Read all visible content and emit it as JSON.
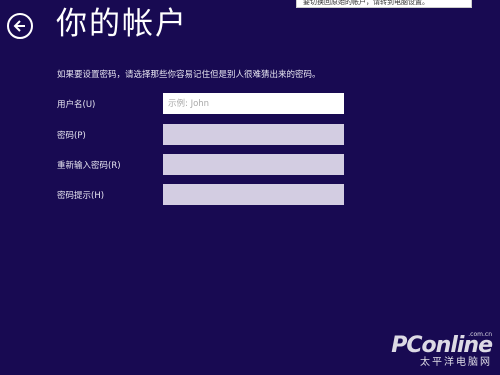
{
  "tooltip": {
    "text": "要切换回原始的帐户，请转到电脑设置。"
  },
  "header": {
    "back_icon": "back-arrow-icon",
    "title": "你的帐户"
  },
  "form": {
    "instruction": "如果要设置密码，请选择那些你容易记住但是别人很难猜出来的密码。",
    "fields": [
      {
        "label": "用户名(U)",
        "value": "",
        "placeholder": "示例: John"
      },
      {
        "label": "密码(P)",
        "value": "",
        "placeholder": ""
      },
      {
        "label": "重新输入密码(R)",
        "value": "",
        "placeholder": ""
      },
      {
        "label": "密码提示(H)",
        "value": "",
        "placeholder": ""
      }
    ]
  },
  "watermark": {
    "brand": "PConline",
    "domain": ".com.cn",
    "subtitle": "太平洋电脑网"
  },
  "colors": {
    "background": "#180a52",
    "active_input": "#ffffff",
    "inactive_input": "#d3cde2"
  }
}
